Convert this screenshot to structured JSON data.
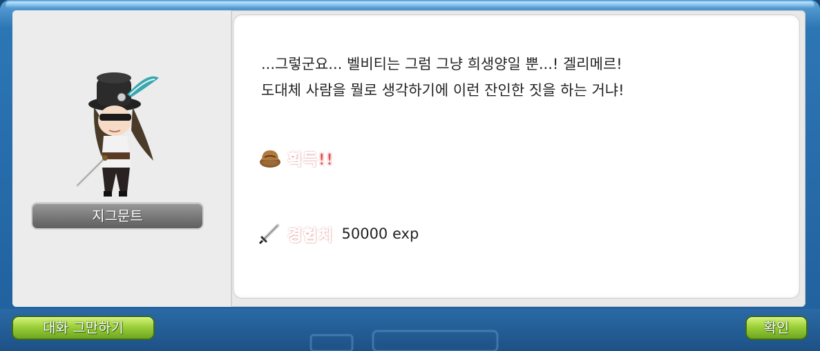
{
  "npc": {
    "name": "지그문트"
  },
  "dialogue": {
    "lines": "...그렇군요... 벨비티는 그럼 그냥 희생양일 뿐...! 겔리메르!\n도대체 사람을 뭘로 생각하기에 이런 잔인한 짓을 하는 거냐!"
  },
  "rewards": {
    "acquire_label": "획득!!",
    "acquire_icon": "bag-icon",
    "exp_label": "경험치",
    "exp_value": "50000 exp",
    "exp_icon": "sword-icon"
  },
  "buttons": {
    "end_chat": "대화 그만하기",
    "ok": "확인"
  },
  "colors": {
    "frame": "#2d76b5",
    "button_green": "#9bd03a",
    "reward_red": "#e35050"
  }
}
